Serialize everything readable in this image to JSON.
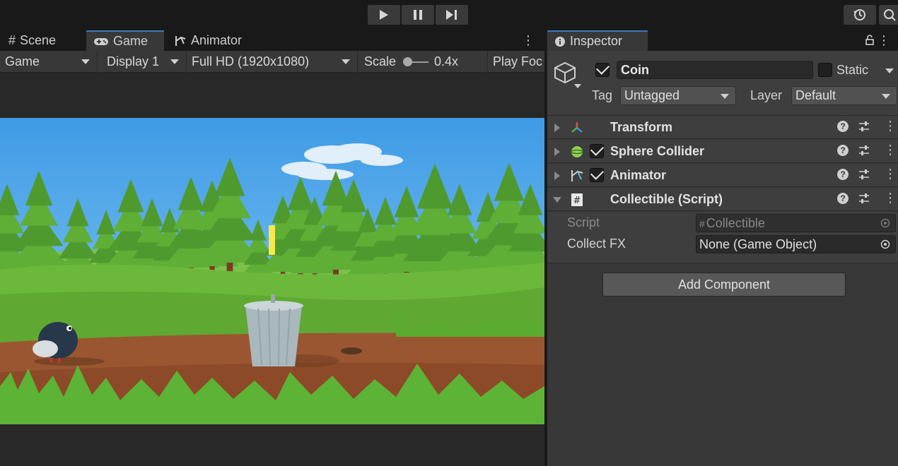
{
  "toolbar": {
    "play_icon": "play-icon",
    "pause_icon": "pause-icon",
    "step_icon": "step-icon",
    "history_icon": "history-icon",
    "search_icon": "search-icon"
  },
  "left_tabs": [
    {
      "label": "Scene",
      "icon": "hash-icon"
    },
    {
      "label": "Game",
      "icon": "gamepad-icon"
    },
    {
      "label": "Animator",
      "icon": "animator-icon"
    }
  ],
  "game_bar": {
    "view_mode": "Game",
    "display": "Display 1",
    "resolution": "Full HD (1920x1080)",
    "scale_label": "Scale",
    "scale_value": "0.4x",
    "scale_fraction": 0.05,
    "play_focused": "Play Foc"
  },
  "inspector": {
    "tab_label": "Inspector",
    "object_name": "Coin",
    "active": true,
    "static_label": "Static",
    "static": false,
    "tag_label": "Tag",
    "tag_value": "Untagged",
    "layer_label": "Layer",
    "layer_value": "Default",
    "components": [
      {
        "title": "Transform",
        "icon": "transform-icon",
        "has_toggle": false,
        "enabled": null,
        "expanded": false
      },
      {
        "title": "Sphere Collider",
        "icon": "sphere-collider-icon",
        "has_toggle": true,
        "enabled": true,
        "expanded": false
      },
      {
        "title": "Animator",
        "icon": "animator-icon",
        "has_toggle": true,
        "enabled": true,
        "expanded": false
      },
      {
        "title": "Collectible (Script)",
        "icon": "script-icon",
        "has_toggle": false,
        "enabled": null,
        "expanded": true
      }
    ],
    "script_props": [
      {
        "label": "Script",
        "value": "Collectible",
        "disabled": true
      },
      {
        "label": "Collect FX",
        "value": "None (Game Object)",
        "disabled": false
      }
    ],
    "add_component_label": "Add Component"
  },
  "colors": {
    "accent": "#3a79bb",
    "panel": "#383838",
    "sky": "#3f9be6",
    "grass": "#6cb83a",
    "dirt": "#9a5630"
  }
}
